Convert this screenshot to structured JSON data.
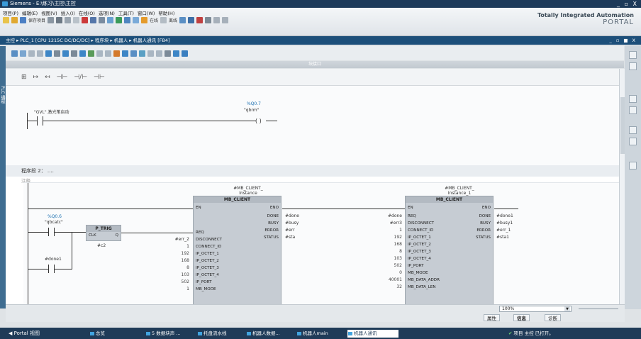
{
  "window": {
    "title": "Siemens - E:\\练习\\主控\\主控",
    "controls": "_ ▫ X"
  },
  "menu": [
    "项目(P)",
    "编辑(E)",
    "视图(V)",
    "插入(I)",
    "在线(O)",
    "选项(N)",
    "工具(T)",
    "窗口(W)",
    "帮助(H)"
  ],
  "toolbar": {
    "save_label": "保存项目",
    "online_label": "在线",
    "offline_label": "离线"
  },
  "tia": {
    "line1": "Totally Integrated Automation",
    "line2": "PORTAL"
  },
  "breadcrumb": {
    "text": "主控 ▸ PLC_1 [CPU 1215C DC/DC/DC] ▸ 程序块 ▸ 机器人 ▸ 机器人通讯 [FB4]",
    "controls": "_ ▫ ■ X"
  },
  "block_interface": "块接口",
  "left_tab": "PLC 编程",
  "network1": {
    "contact_tag": "\"GVL\".激光笔启动",
    "coil_addr": "%Q0.7",
    "coil_tag": "\"qbrm\""
  },
  "network2": {
    "title": "程序段 2：  ....",
    "comment": "注释",
    "contact1_addr": "%Q0.6",
    "contact1_tag": "\"qbcatc\"",
    "trig_title": "P_TRIG",
    "trig_clk": "CLK",
    "trig_q": "Q",
    "trig_mem": "#c2",
    "contact2_tag": "#done1",
    "fb1": {
      "instance": "#MB_CLIENT_",
      "instance2": "Instance",
      "title": "MB_CLIENT",
      "en": "EN",
      "eno": "ENO",
      "outputs": [
        {
          "pin": "DONE",
          "var": "#done"
        },
        {
          "pin": "BUSY",
          "var": "#busy"
        },
        {
          "pin": "ERROR",
          "var": "#err"
        },
        {
          "pin": "STATUS",
          "var": "#sta"
        }
      ],
      "inputs": [
        {
          "val": "",
          "pin": "REQ"
        },
        {
          "val": "#err_2",
          "pin": "DISCONNECT"
        },
        {
          "val": "1",
          "pin": "CONNECT_ID"
        },
        {
          "val": "192",
          "pin": "IP_OCTET_1"
        },
        {
          "val": "168",
          "pin": "IP_OCTET_2"
        },
        {
          "val": "8",
          "pin": "IP_OCTET_3"
        },
        {
          "val": "103",
          "pin": "IP_OCTET_4"
        },
        {
          "val": "502",
          "pin": "IP_PORT"
        },
        {
          "val": "1",
          "pin": "MB_MODE"
        }
      ]
    },
    "fb2": {
      "instance": "#MB_CLIENT_",
      "instance2": "Instance_1",
      "title": "MB_CLIENT",
      "en": "EN",
      "eno": "ENO",
      "outputs": [
        {
          "pin": "DONE",
          "var": "#done1"
        },
        {
          "pin": "BUSY",
          "var": "#busy1"
        },
        {
          "pin": "ERROR",
          "var": "#err_1"
        },
        {
          "pin": "STATUS",
          "var": "#sta1"
        }
      ],
      "inputs": [
        {
          "val": "#done",
          "pin": "REQ"
        },
        {
          "val": "#err3",
          "pin": "DISCONNECT"
        },
        {
          "val": "1",
          "pin": "CONNECT_ID"
        },
        {
          "val": "192",
          "pin": "IP_OCTET_1"
        },
        {
          "val": "168",
          "pin": "IP_OCTET_2"
        },
        {
          "val": "8",
          "pin": "IP_OCTET_3"
        },
        {
          "val": "103",
          "pin": "IP_OCTET_4"
        },
        {
          "val": "502",
          "pin": "IP_PORT"
        },
        {
          "val": "0",
          "pin": "MB_MODE"
        },
        {
          "val": "40001",
          "pin": "MB_DATA_ADDR"
        },
        {
          "val": "32",
          "pin": "MB_DATA_LEN"
        }
      ]
    }
  },
  "zoom": "100%",
  "panel_tabs": {
    "properties": "属性",
    "info": "信息",
    "diagnostics": "诊断"
  },
  "taskbar": {
    "portal": "◀ Portal 视图",
    "items": [
      "总览",
      "5 数据块声 ...",
      "托盘流水线",
      "机器人数据...",
      "机器人main",
      "机器人通讯"
    ],
    "status": "项目 主控 已打开。"
  }
}
